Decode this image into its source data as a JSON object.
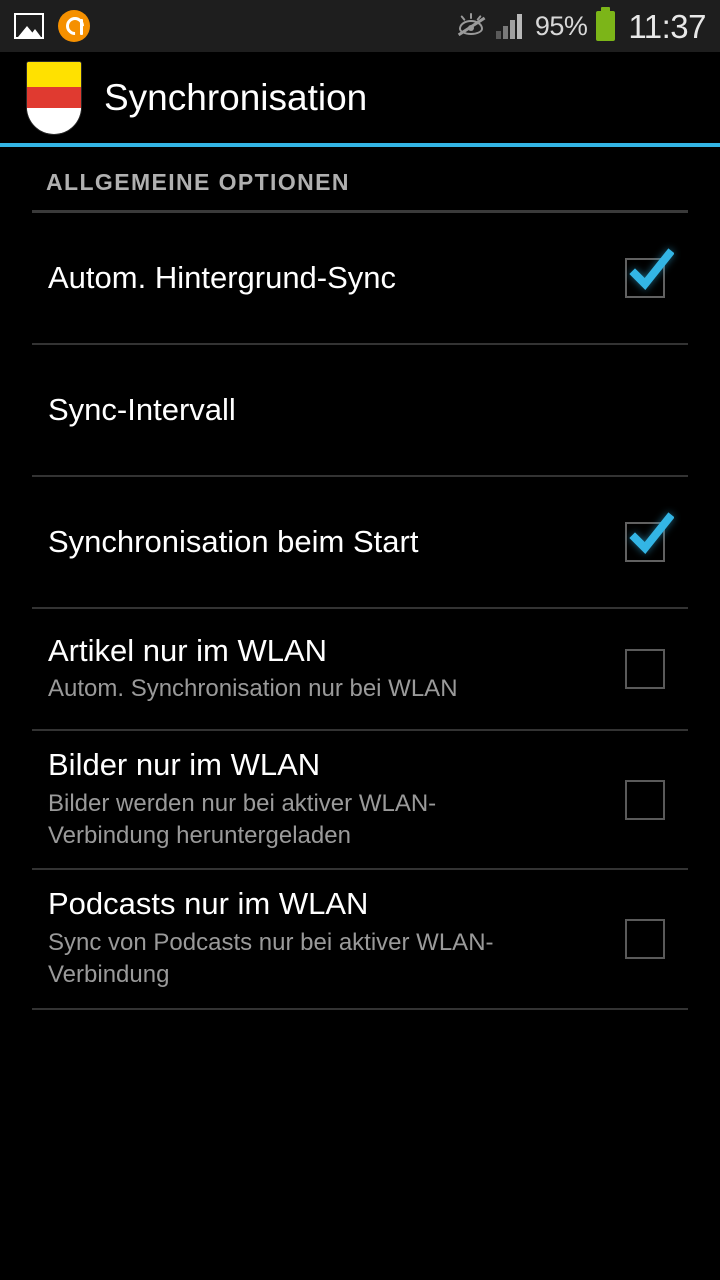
{
  "status_bar": {
    "notification_icons": [
      {
        "name": "screenshot-image-icon",
        "label": "image"
      },
      {
        "name": "app-orange-icon",
        "label": "app"
      }
    ],
    "smart_stay_icon": "eye-off-icon",
    "signal_icon": "signal-bars-icon",
    "battery_percent": "95%",
    "battery_icon": "battery-full-icon",
    "clock": "11:37",
    "background_color": "#1e1e1e"
  },
  "action_bar": {
    "app_icon": "crest-shield-icon",
    "title": "Synchronisation",
    "accent_color": "#33b5e5",
    "background_color": "#000000"
  },
  "preferences": {
    "section_header": "ALLGEMEINE OPTIONEN",
    "items": [
      {
        "title": "Autom. Hintergrund-Sync",
        "summary": "",
        "widget": "checkbox",
        "checked": true
      },
      {
        "title": "Sync-Intervall",
        "summary": "",
        "widget": "none",
        "checked": false
      },
      {
        "title": "Synchronisation beim Start",
        "summary": "",
        "widget": "checkbox",
        "checked": true
      },
      {
        "title": "Artikel nur im WLAN",
        "summary": "Autom. Synchronisation nur bei WLAN",
        "widget": "checkbox",
        "checked": false
      },
      {
        "title": "Bilder nur im WLAN",
        "summary": "Bilder werden nur bei aktiver WLAN-Verbindung heruntergeladen",
        "widget": "checkbox",
        "checked": false
      },
      {
        "title": "Podcasts nur im WLAN",
        "summary": "Sync von Podcasts nur bei aktiver WLAN-Verbindung",
        "widget": "checkbox",
        "checked": false
      }
    ]
  }
}
